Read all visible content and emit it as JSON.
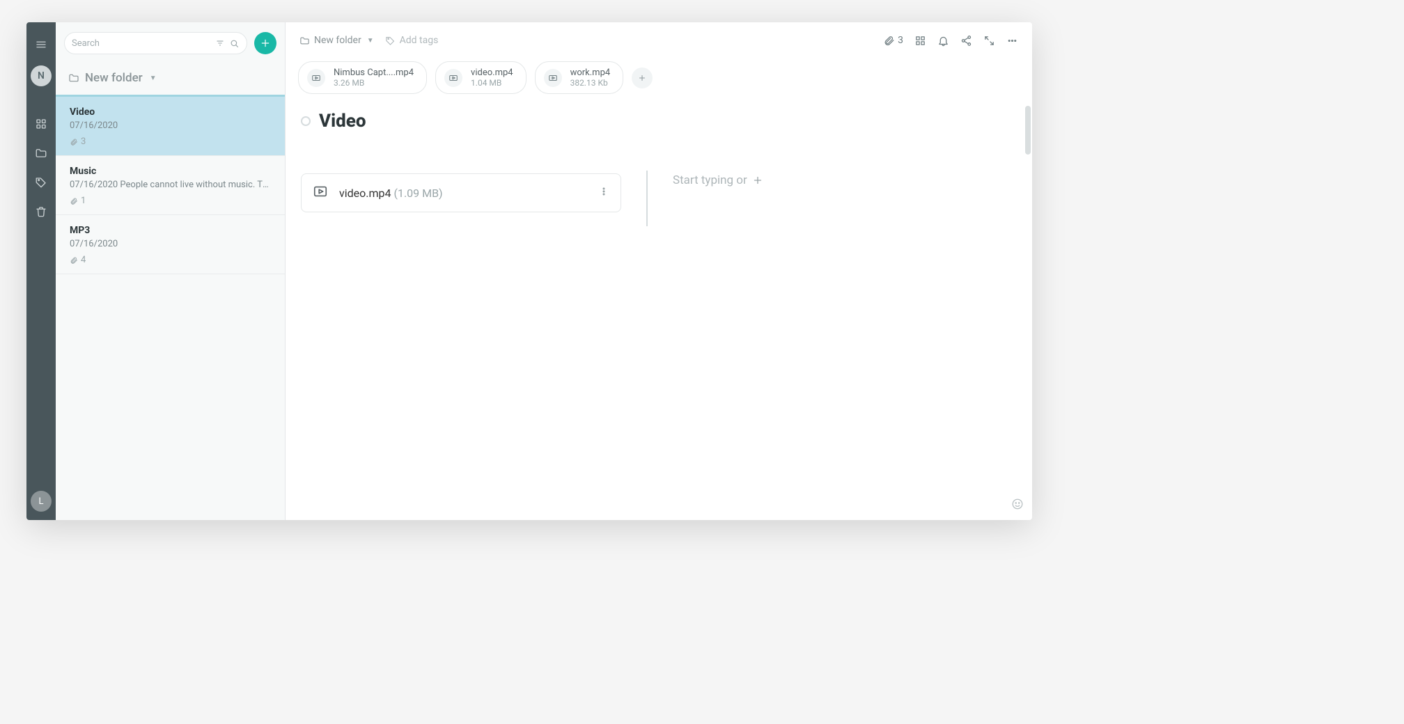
{
  "rail": {
    "avatar_top": "N",
    "avatar_bottom": "L"
  },
  "sidebar": {
    "search_placeholder": "Search",
    "folder_label": "New folder",
    "notes": [
      {
        "title": "Video",
        "date": "07/16/2020",
        "preview": "",
        "attachments": "3",
        "active": true
      },
      {
        "title": "Music",
        "date": "07/16/2020",
        "preview": "People cannot live without music. They l...",
        "attachments": "1",
        "active": false
      },
      {
        "title": "MP3",
        "date": "07/16/2020",
        "preview": "",
        "attachments": "4",
        "active": false
      }
    ]
  },
  "topbar": {
    "breadcrumb": "New folder",
    "tags_placeholder": "Add tags",
    "attach_count": "3"
  },
  "attachments": [
    {
      "name": "Nimbus Capt....mp4",
      "size": "3.26 MB"
    },
    {
      "name": "video.mp4",
      "size": "1.04 MB"
    },
    {
      "name": "work.mp4",
      "size": "382.13 Kb"
    }
  ],
  "page": {
    "title": "Video",
    "file_block": {
      "name": "video.mp4",
      "size": "(1.09 MB)"
    },
    "placeholder": "Start typing or"
  }
}
